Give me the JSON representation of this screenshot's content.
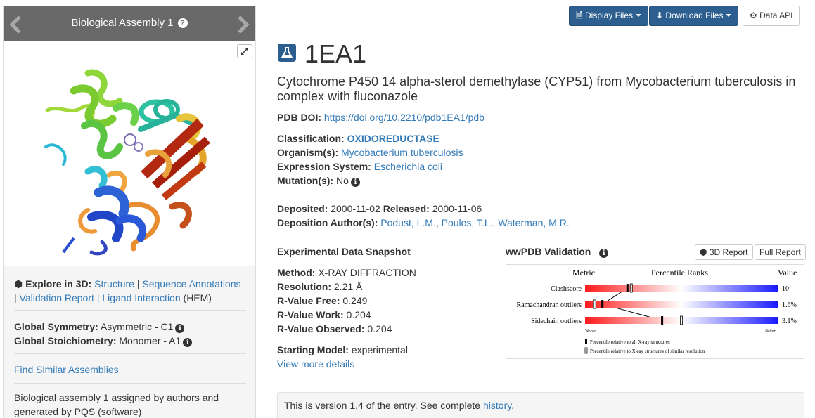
{
  "left_panel": {
    "carousel_title": "Biological Assembly 1",
    "explore": {
      "label": "Explore in 3D",
      "links": [
        "Structure",
        "Sequence Annotations",
        "Validation Report",
        "Ligand Interaction"
      ],
      "ligand_suffix": "(HEM)"
    },
    "symmetry": {
      "label": "Global Symmetry",
      "value": "Asymmetric - C1"
    },
    "stoichiometry": {
      "label": "Global Stoichiometry",
      "value": "Monomer - A1"
    },
    "similar_link": "Find Similar Assemblies",
    "assembly_note": "Biological assembly 1 assigned by authors and generated by PQS (software)"
  },
  "toolbar": {
    "display_files": "Display Files",
    "download_files": "Download Files",
    "data_api": "Data API"
  },
  "entry": {
    "id": "1EA1",
    "title": "Cytochrome P450 14 alpha-sterol demethylase (CYP51) from Mycobacterium tuberculosis in complex with fluconazole",
    "doi_label": "PDB DOI:",
    "doi": "https://doi.org/10.2210/pdb1EA1/pdb",
    "classification_label": "Classification:",
    "classification": "OXIDOREDUCTASE",
    "organism_label": "Organism(s):",
    "organism": "Mycobacterium tuberculosis",
    "expression_label": "Expression System:",
    "expression": "Escherichia coli",
    "mutation_label": "Mutation(s):",
    "mutation": "No",
    "deposited_label": "Deposited:",
    "deposited": "2000-11-02",
    "released_label": "Released:",
    "released": "2000-11-06",
    "authors_label": "Deposition Author(s):",
    "authors": [
      "Podust, L.M.",
      "Poulos, T.L.",
      "Waterman, M.R."
    ]
  },
  "experimental": {
    "heading": "Experimental Data Snapshot",
    "method_label": "Method:",
    "method": "X-RAY DIFFRACTION",
    "resolution_label": "Resolution:",
    "resolution": "2.21 Å",
    "rfree_label": "R-Value Free:",
    "rfree": "0.249",
    "rwork_label": "R-Value Work:",
    "rwork": "0.204",
    "robs_label": "R-Value Observed:",
    "robs": "0.204",
    "starting_label": "Starting Model:",
    "starting": "experimental",
    "more_link": "View more details"
  },
  "validation": {
    "heading": "wwPDB Validation",
    "report_3d": "3D Report",
    "full_report": "Full Report",
    "col_metric": "Metric",
    "col_ranks": "Percentile Ranks",
    "col_value": "Value",
    "metrics": [
      {
        "name": "Clashscore",
        "value": "10",
        "pct_all": 0.22,
        "pct_res": 0.24
      },
      {
        "name": "Ramachandran outliers",
        "value": "1.6%",
        "pct_all": 0.09,
        "pct_res": 0.05
      },
      {
        "name": "Sidechain outliers",
        "value": "3.1%",
        "pct_all": 0.4,
        "pct_res": 0.5
      }
    ],
    "worse": "Worse",
    "better": "Better",
    "legend_all": "Percentile relative to all X-ray structures",
    "legend_res": "Percentile relative to X-ray structures of similar resolution"
  },
  "history": {
    "text": "This is version 1.4 of the entry. See complete",
    "link": "history"
  }
}
